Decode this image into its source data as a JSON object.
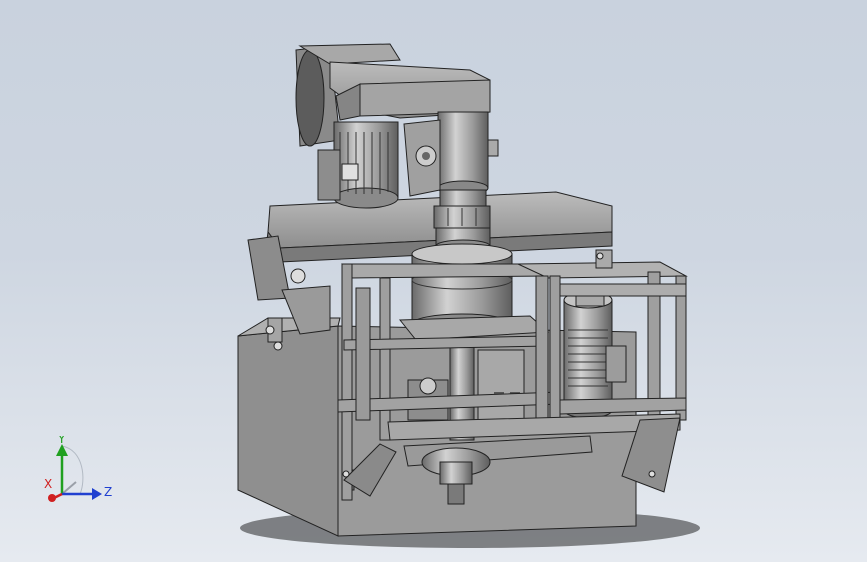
{
  "view": {
    "type": "3d-cad-isometric",
    "background_top": "#c9d2de",
    "background_bottom": "#e6eaf0"
  },
  "triad": {
    "x_label": "X",
    "y_label": "Y",
    "z_label": "Z",
    "x_color": "#d02020",
    "y_color": "#20a020",
    "z_color": "#2040d0"
  }
}
